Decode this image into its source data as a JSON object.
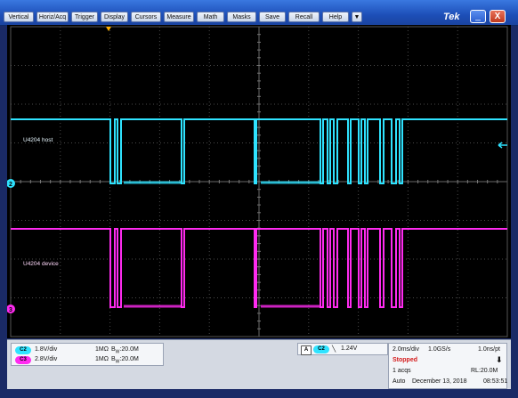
{
  "menu": {
    "items": [
      "Vertical",
      "Horiz/Acq",
      "Trigger",
      "Display",
      "Cursors",
      "Measure",
      "Math",
      "Masks",
      "Save",
      "Recall",
      "Help"
    ],
    "dropdown_glyph": "▼",
    "brand": "Tek",
    "minimize_glyph": "_",
    "close_glyph": "X"
  },
  "channels": [
    {
      "id": "2",
      "label": "U4204 host",
      "color": "#2fe3ff"
    },
    {
      "id": "3",
      "label": "U4204 device",
      "color": "#ff2bf0"
    }
  ],
  "readout": {
    "ch2": {
      "badge": "C2",
      "scale": "1.8V/div",
      "coupling": "1MΩ",
      "bw_prefix": "B",
      "bw_sub": "W",
      "bw_value": ":20.0M"
    },
    "ch3": {
      "badge": "C3",
      "scale": "2.8V/div",
      "coupling": "1MΩ",
      "bw_prefix": "B",
      "bw_sub": "W",
      "bw_value": ":20.0M"
    },
    "trigger": {
      "mode_badge": "A",
      "source_badge": "C2",
      "slope_glyph": "╲",
      "level": "1.24V"
    },
    "horizontal": {
      "time_div": "2.0ms/div",
      "sample_rate": "1.0GS/s",
      "pt_rate": "1.0ns/pt"
    },
    "status": {
      "state": "Stopped",
      "acqs": "1 acqs",
      "record_length": "RL:20.0M",
      "mode": "Auto",
      "date": "December 13, 2018",
      "time": "08:53:51"
    }
  },
  "colors": {
    "ch2": "#2fe3ff",
    "ch3": "#ff2bf0",
    "stopped": "#d41a1a"
  }
}
